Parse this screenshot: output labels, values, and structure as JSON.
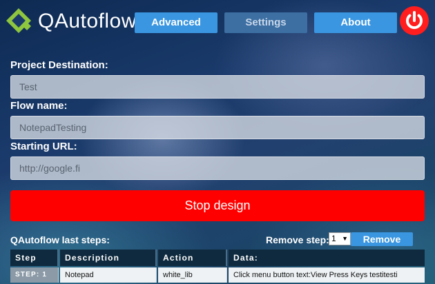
{
  "brand": {
    "name": "QAutoflow"
  },
  "nav": {
    "advanced": "Advanced",
    "settings": "Settings",
    "about": "About"
  },
  "form": {
    "destination_label": "Project Destination:",
    "destination_value": "Test",
    "flow_label": "Flow name:",
    "flow_value": "NotepadTesting",
    "url_label": "Starting URL:",
    "url_value": "http://google.fi"
  },
  "stop_button": "Stop design",
  "steps": {
    "title": "QAutoflow last steps:",
    "remove_label": "Remove step:",
    "selected_step": "1",
    "remove_button": "Remove",
    "columns": [
      "Step",
      "Description",
      "Action",
      "Data:"
    ],
    "rows": [
      {
        "step": "STEP: 1",
        "description": "Notepad",
        "action": "white_lib",
        "data": "Click menu button text:View Press Keys testitesti"
      }
    ]
  },
  "colors": {
    "accent": "#3a96e0",
    "danger": "#ff0000",
    "header": "#0f2a3e"
  },
  "icons": {
    "logo": "qautoflow-logo-icon",
    "power": "power-icon",
    "dropdown": "chevron-down-icon"
  }
}
